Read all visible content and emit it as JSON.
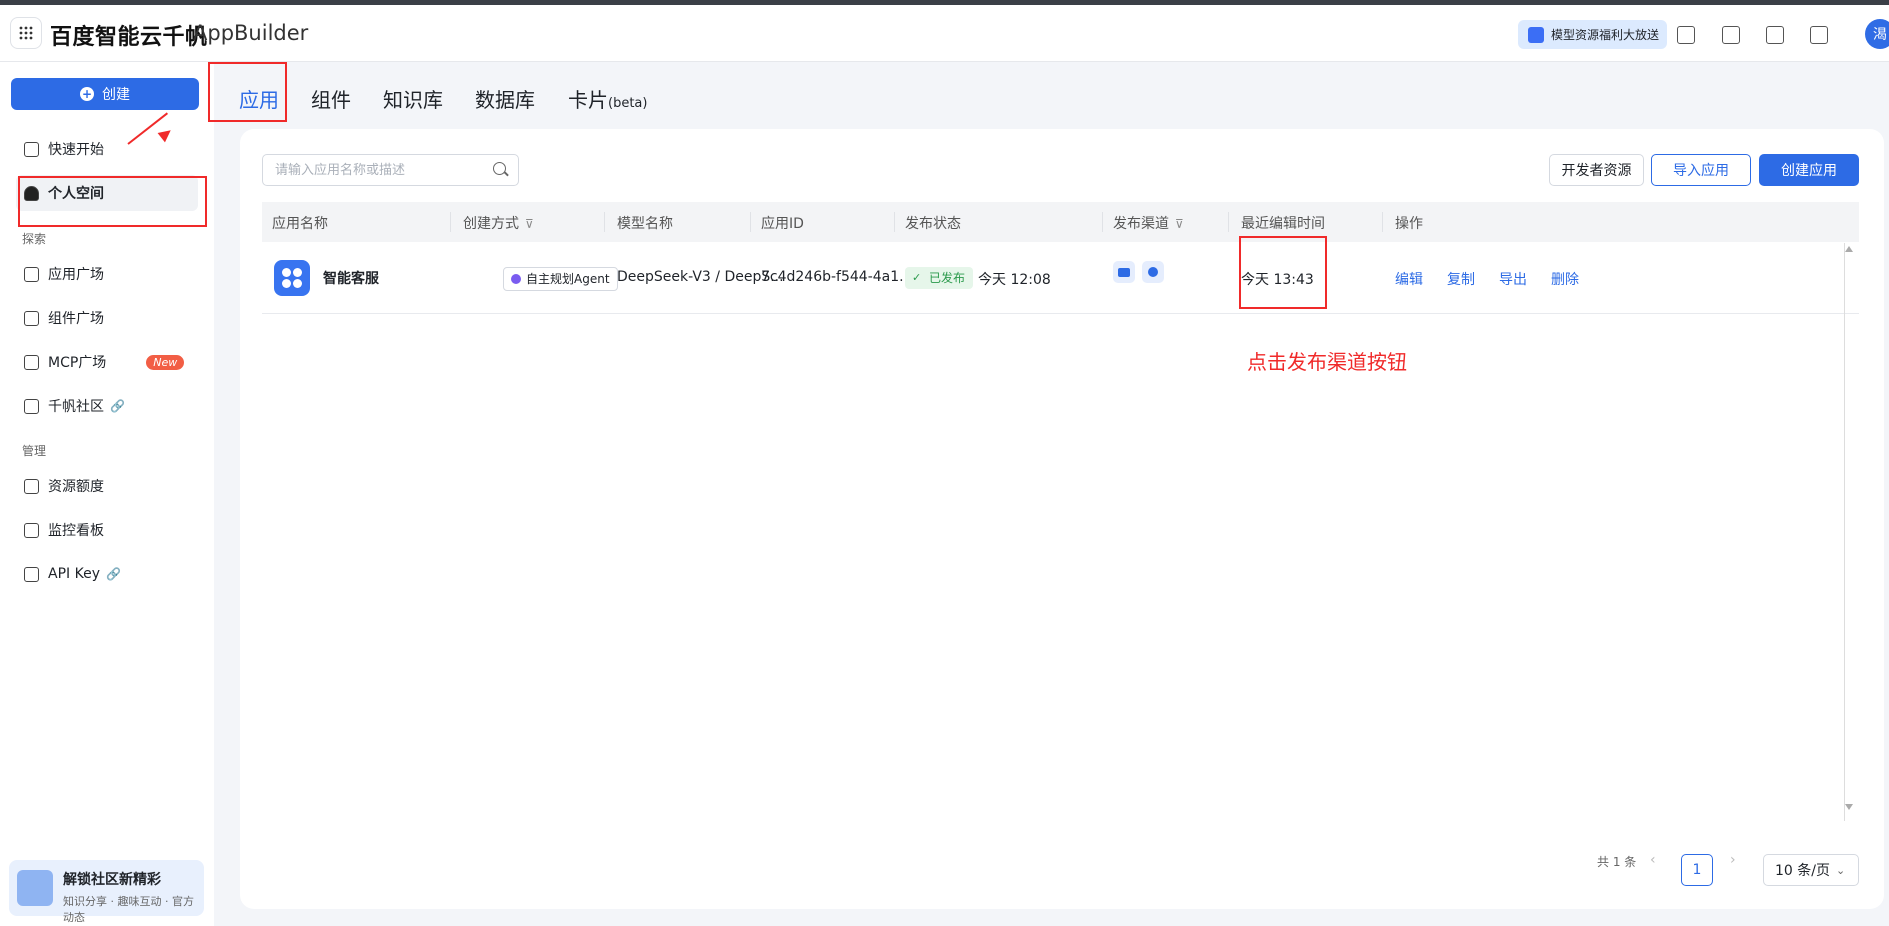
{
  "topbar": {
    "brand": "百度智能云千帆",
    "product": "AppBuilder",
    "promo_label": "模型资源福利大放送",
    "avatar_text": "渴"
  },
  "sidebar": {
    "create_label": "创建",
    "items_top": [
      {
        "label": "快速开始",
        "icon": "quickstart-icon"
      },
      {
        "label": "个人空间",
        "icon": "person-icon"
      }
    ],
    "section_explore": "探索",
    "items_explore": [
      {
        "label": "应用广场",
        "icon": "apps-grid-icon"
      },
      {
        "label": "组件广场",
        "icon": "component-icon"
      },
      {
        "label": "MCP广场",
        "icon": "mcp-icon",
        "badge": "New"
      },
      {
        "label": "千帆社区",
        "icon": "community-icon"
      }
    ],
    "section_manage": "管理",
    "items_manage": [
      {
        "label": "资源额度",
        "icon": "resource-icon"
      },
      {
        "label": "监控看板",
        "icon": "monitor-icon"
      },
      {
        "label": "API Key",
        "icon": "key-icon"
      }
    ],
    "promo_card": {
      "title": "解锁社区新精彩",
      "subtitle": "知识分享 · 趣味互动 · 官方动态"
    }
  },
  "tabs": [
    "应用",
    "组件",
    "知识库",
    "数据库",
    "卡片"
  ],
  "tab_card_suffix": "(beta)",
  "toolbar": {
    "search_placeholder": "请输入应用名称或描述",
    "dev_resources": "开发者资源",
    "import_app": "导入应用",
    "create_app": "创建应用"
  },
  "table": {
    "headers": [
      "应用名称",
      "创建方式",
      "模型名称",
      "应用ID",
      "发布状态",
      "发布渠道",
      "最近编辑时间",
      "操作"
    ],
    "rows": [
      {
        "name": "智能客服",
        "create_mode": "自主规划Agent",
        "model": "DeepSeek-V3 / DeepS...",
        "app_id": "7c4d246b-f544-4a1...",
        "status": "已发布",
        "published_time": "今天 12:08",
        "edited_time": "今天 13:43",
        "actions": [
          "编辑",
          "复制",
          "导出",
          "删除"
        ]
      }
    ]
  },
  "pagination": {
    "total": "共 1 条",
    "current_page": "1",
    "page_size": "10 条/页"
  },
  "annotation": {
    "text": "点击发布渠道按钮",
    "color": "#f02a2a"
  },
  "colors": {
    "accent": "#2d6be5",
    "success": "#2b9a4c",
    "annotation_red": "#f02a2a"
  }
}
